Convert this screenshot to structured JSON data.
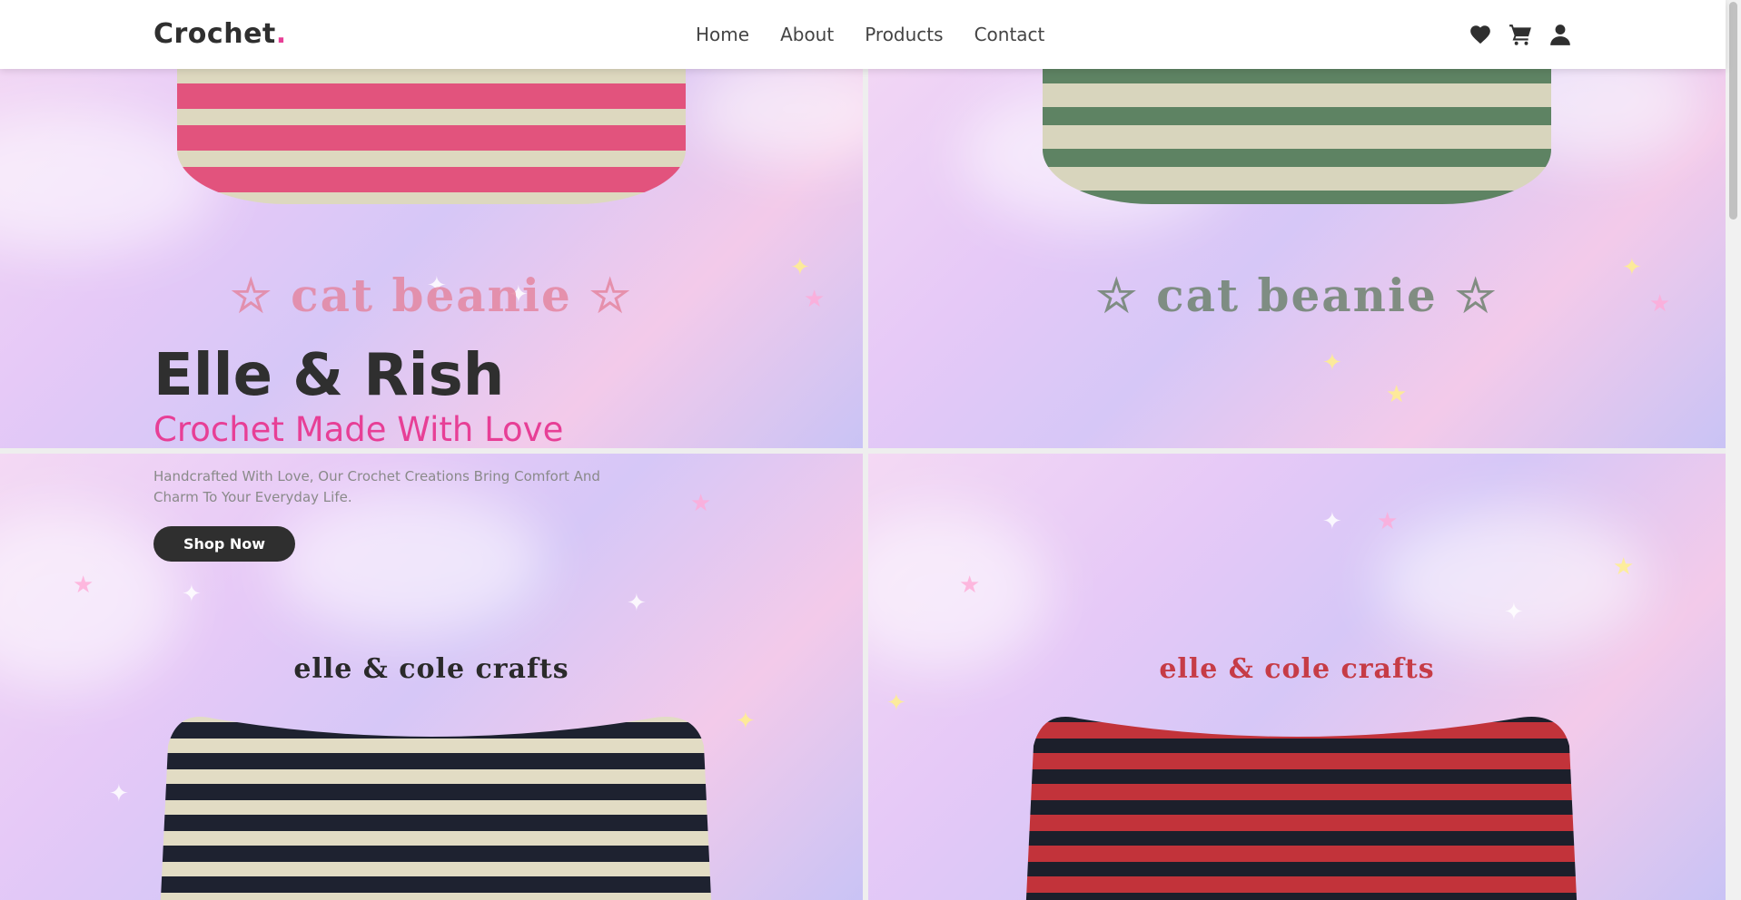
{
  "header": {
    "logo_text": "Crochet",
    "logo_dot": ".",
    "nav": [
      "Home",
      "About",
      "Products",
      "Contact"
    ],
    "icons": [
      "heart-icon",
      "cart-icon",
      "user-icon"
    ]
  },
  "hero": {
    "title": "Elle & Rish",
    "subtitle": "Crochet Made With Love",
    "description": "Handcrafted With Love, Our Crochet Creations Bring Comfort And Charm To Your Everyday Life.",
    "button_label": "Shop Now"
  },
  "tiles": [
    {
      "caption": "☆ cat beanie ☆"
    },
    {
      "caption": "☆ cat beanie ☆"
    },
    {
      "caption": "elle & cole crafts"
    },
    {
      "caption": "elle & cole crafts"
    }
  ],
  "colors": {
    "accent": "#e73f96",
    "text_dark": "#2f2f2f"
  }
}
